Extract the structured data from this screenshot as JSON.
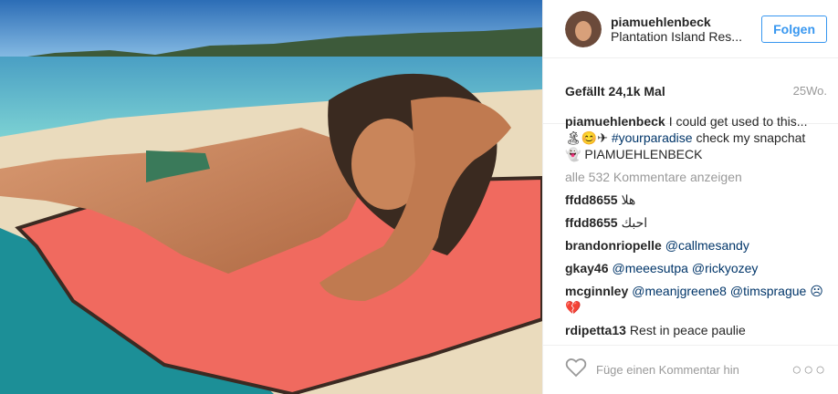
{
  "post": {
    "username": "piamuehlenbeck",
    "location": "Plantation Island Res...",
    "follow_label": "Folgen",
    "likes": "Gefällt 24,1k Mal",
    "age": "25Wo."
  },
  "caption": {
    "user": "piamuehlenbeck",
    "text_before": "I could get used to this... 🏝😊✈ ",
    "hashtag": "#yourparadise",
    "text_after": " check my snapchat 👻 PIAMUEHLENBECK"
  },
  "show_all": "alle 532 Kommentare anzeigen",
  "comments": [
    {
      "user": "ffdd8655",
      "text": "هلا",
      "tag": ""
    },
    {
      "user": "ffdd8655",
      "text": "احبك",
      "tag": ""
    },
    {
      "user": "brandonriopelle",
      "text": "",
      "tag": "@callmesandy"
    },
    {
      "user": "gkay46",
      "text": "",
      "tag": "@meeesutpa @rickyozey"
    },
    {
      "user": "mcginnley",
      "text": "",
      "tag": "@meanjgreene8 @timsprague ☹ 💔"
    },
    {
      "user": "rdipetta13",
      "text": "Rest in peace paulie",
      "tag": ""
    }
  ],
  "footer": {
    "add_comment_placeholder": "Füge einen Kommentar hin",
    "more_label": "○○○"
  },
  "colors": {
    "accent": "#3897f0",
    "tag": "#003569",
    "sea": "#4fc0c4",
    "sand": "#e9d9b8",
    "towel_red": "#f06a5f",
    "towel_teal": "#1a8e95"
  }
}
